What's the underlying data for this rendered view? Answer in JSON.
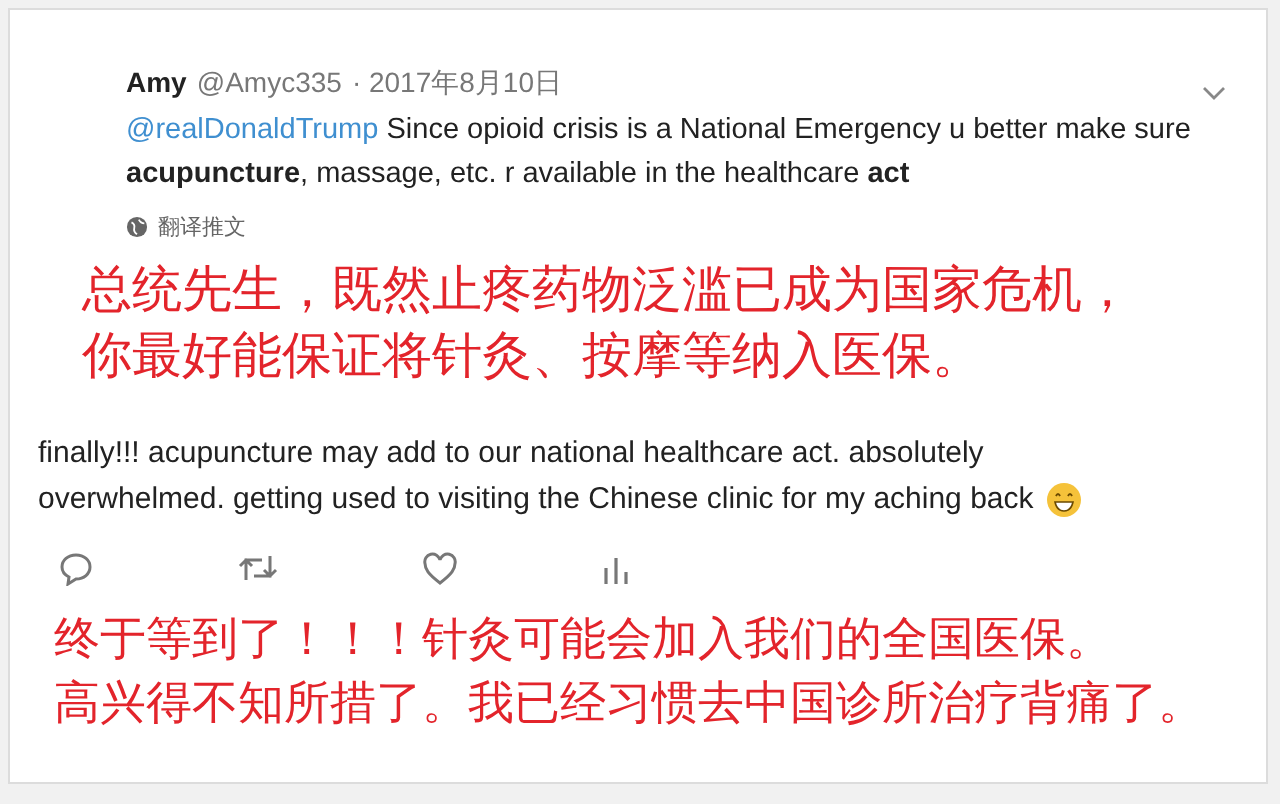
{
  "tweet": {
    "author_name": "Amy",
    "handle": "@Amyc335",
    "date": "· 2017年8月10日",
    "mention": "@realDonaldTrump",
    "text": "Since opioid crisis is a National Emergency u better make sure **acupuncture**, massage, etc. r available in the healthcare **act**",
    "translate_label": "翻译推文"
  },
  "caption_1": [
    "总统先生，既然止疼药物泛滥已成为国家危机，",
    "你最好能保证将针灸、按摩等纳入医保。"
  ],
  "reply": {
    "lines": [
      "finally!!! acupuncture may add to our national healthcare act. absolutely",
      "overwhelmed. getting used to visiting the Chinese clinic for my aching back"
    ]
  },
  "caption_2": [
    "终于等到了！！！针灸可能会加入我们的全国医保。",
    "高兴得不知所措了。我已经习惯去中国诊所治疗背痛了。"
  ]
}
